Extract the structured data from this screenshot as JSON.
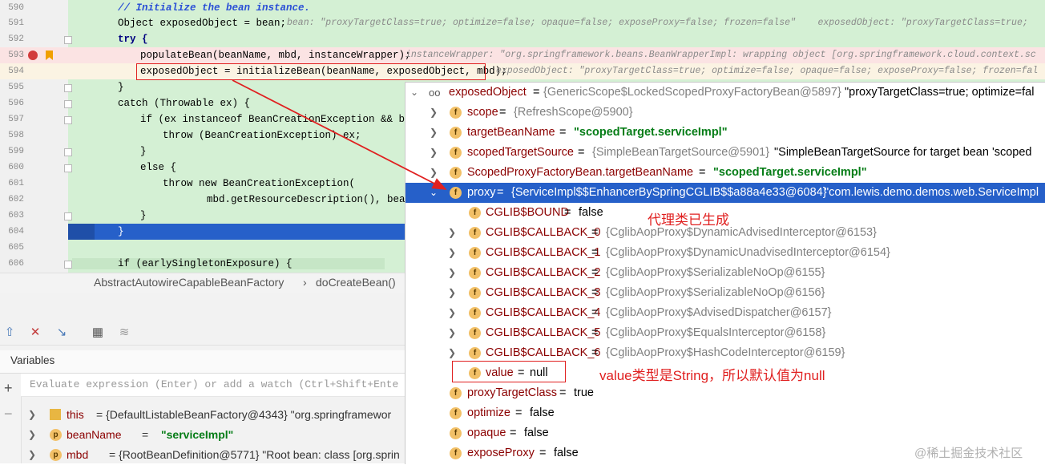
{
  "editor": {
    "lines": [
      {
        "n": "590",
        "text": "// Initialize the bean instance."
      },
      {
        "n": "591",
        "text": "Object exposedObject = bean;",
        "hint": "bean: \"proxyTargetClass=true; optimize=false; opaque=false; exposeProxy=false; frozen=false\"    exposedObject: \"proxyTargetClass=true;"
      },
      {
        "n": "592",
        "text": "try {"
      },
      {
        "n": "593",
        "text": "populateBean(beanName, mbd, instanceWrapper);",
        "hint": "instanceWrapper: \"org.springframework.beans.BeanWrapperImpl: wrapping object [org.springframework.cloud.context.sc"
      },
      {
        "n": "594",
        "text": "exposedObject = initializeBean(beanName, exposedObject, mbd);",
        "hint": "exposedObject: \"proxyTargetClass=true; optimize=false; opaque=false; exposeProxy=false; frozen=fal"
      },
      {
        "n": "595",
        "text": "}"
      },
      {
        "n": "596",
        "text": "catch (Throwable ex) {"
      },
      {
        "n": "597",
        "text": "if (ex instanceof BeanCreationException && bean"
      },
      {
        "n": "598",
        "text": "throw (BeanCreationException) ex;"
      },
      {
        "n": "599",
        "text": "}"
      },
      {
        "n": "600",
        "text": "else {"
      },
      {
        "n": "601",
        "text": "throw new BeanCreationException("
      },
      {
        "n": "602",
        "text": "mbd.getResourceDescription(), beanN"
      },
      {
        "n": "603",
        "text": "}"
      },
      {
        "n": "604",
        "text": "}"
      },
      {
        "n": "605",
        "text": ""
      },
      {
        "n": "606",
        "text": "if (earlySingletonExposure) {"
      }
    ]
  },
  "breadcrumb": {
    "class_name": "AbstractAutowireCapableBeanFactory",
    "separator": "›",
    "method": "doCreateBean()"
  },
  "debug": {
    "variables_title": "Variables",
    "watch_placeholder": "Evaluate expression (Enter) or add a watch (Ctrl+Shift+Ente",
    "variables": [
      {
        "icon": "≡",
        "name": "this",
        "value": "= {DefaultListableBeanFactory@4343} \"org.springframewor"
      },
      {
        "icon": "p",
        "name": "beanName",
        "value": "= ",
        "str": "\"serviceImpl\""
      },
      {
        "icon": "p",
        "name": "mbd",
        "value": "= {RootBeanDefinition@5771} \"Root bean: class [org.sprin"
      }
    ]
  },
  "popup": {
    "rows": [
      {
        "name": "exposedObject",
        "eq": " = ",
        "ref": "{GenericScope$LockedScopedProxyFactoryBean@5897}",
        "tail": " \"proxyTargetClass=true; optimize=fal"
      },
      {
        "name": "scope",
        "eq": " = ",
        "ref": "{RefreshScope@5900}",
        "tail": ""
      },
      {
        "name": "targetBeanName",
        "eq": " = ",
        "str": "\"scopedTarget.serviceImpl\""
      },
      {
        "name": "scopedTargetSource",
        "eq": " = ",
        "ref": "{SimpleBeanTargetSource@5901}",
        "tail": " \"SimpleBeanTargetSource for target bean 'scoped"
      },
      {
        "name": "ScopedProxyFactoryBean.targetBeanName",
        "eq": " = ",
        "str": "\"scopedTarget.serviceImpl\""
      },
      {
        "name": "proxy",
        "eq": " = ",
        "ref": "{ServiceImpl$$EnhancerBySpringCGLIB$$a88a4e33@6084}",
        "tail": " \"com.lewis.demo.demos.web.ServiceImpl"
      },
      {
        "name": "CGLIB$BOUND",
        "eq": " = ",
        "plain": "false"
      },
      {
        "name": "CGLIB$CALLBACK_0",
        "eq": " = ",
        "ref": "{CglibAopProxy$DynamicAdvisedInterceptor@6153}"
      },
      {
        "name": "CGLIB$CALLBACK_1",
        "eq": " = ",
        "ref": "{CglibAopProxy$DynamicUnadvisedInterceptor@6154}"
      },
      {
        "name": "CGLIB$CALLBACK_2",
        "eq": " = ",
        "ref": "{CglibAopProxy$SerializableNoOp@6155}"
      },
      {
        "name": "CGLIB$CALLBACK_3",
        "eq": " = ",
        "ref": "{CglibAopProxy$SerializableNoOp@6156}"
      },
      {
        "name": "CGLIB$CALLBACK_4",
        "eq": " = ",
        "ref": "{CglibAopProxy$AdvisedDispatcher@6157}"
      },
      {
        "name": "CGLIB$CALLBACK_5",
        "eq": " = ",
        "ref": "{CglibAopProxy$EqualsInterceptor@6158}"
      },
      {
        "name": "CGLIB$CALLBACK_6",
        "eq": " = ",
        "ref": "{CglibAopProxy$HashCodeInterceptor@6159}"
      },
      {
        "name": "value",
        "eq": " = ",
        "plain": "null"
      },
      {
        "name": "proxyTargetClass",
        "eq": " = ",
        "plain": "true"
      },
      {
        "name": "optimize",
        "eq": " = ",
        "plain": "false"
      },
      {
        "name": "opaque",
        "eq": " = ",
        "plain": "false"
      },
      {
        "name": "exposeProxy",
        "eq": " = ",
        "plain": "false"
      }
    ]
  },
  "annotations": {
    "proxy_generated": "代理类已生成",
    "value_note": "value类型是String，所以默认值为null",
    "watermark": "@稀土掘金技术社区"
  },
  "colors": {
    "selection": "#2660c9",
    "annotation": "#e02020",
    "code_bg": "#d4f0d4"
  }
}
